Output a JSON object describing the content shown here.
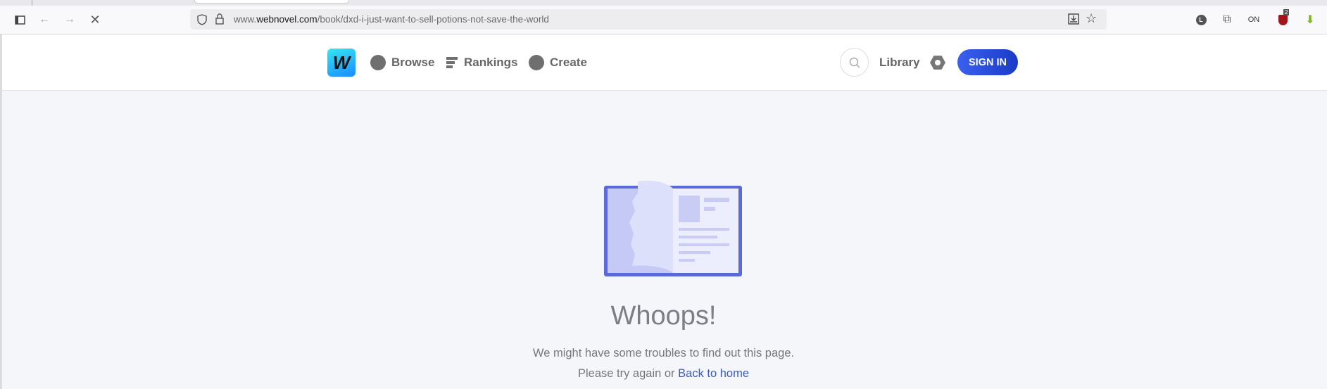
{
  "browser": {
    "url_domain_prefix": "www.",
    "url_domain": "webnovel.com",
    "url_path": "/book/dxd-i-just-want-to-sell-potions-not-save-the-world",
    "extensions": [
      {
        "name": "l-extension",
        "label": "L"
      },
      {
        "name": "puzzle"
      },
      {
        "name": "on-extension",
        "label": "ON"
      },
      {
        "name": "ublock",
        "badge": "2"
      },
      {
        "name": "green-download"
      }
    ]
  },
  "header": {
    "logo": "W",
    "nav": [
      {
        "label": "Browse",
        "icon": "compass-icon"
      },
      {
        "label": "Rankings",
        "icon": "rankings-icon"
      },
      {
        "label": "Create",
        "icon": "pen-icon"
      }
    ],
    "library": "Library",
    "signin": "SIGN IN"
  },
  "main": {
    "title": "Whoops!",
    "message": "We might have some troubles to find out this page.",
    "retry_prefix": "Please try again or",
    "home_link": "Back to home"
  },
  "colors": {
    "accent": "#2a4ee0",
    "link": "#3a5bc7",
    "background": "#f5f6fa"
  }
}
